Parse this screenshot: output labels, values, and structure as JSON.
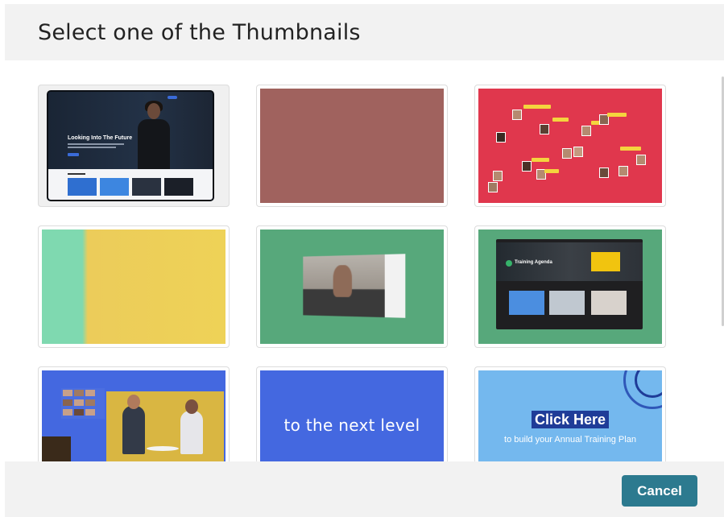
{
  "dialog": {
    "title": "Select one of the Thumbnails",
    "cancel_label": "Cancel"
  },
  "thumbnails": [
    {
      "id": 1,
      "headline": "Looking Into The Future"
    },
    {
      "id": 2
    },
    {
      "id": 3
    },
    {
      "id": 4
    },
    {
      "id": 5
    },
    {
      "id": 6,
      "headline": "Training Agenda"
    },
    {
      "id": 7
    },
    {
      "id": 8,
      "caption": "to the next level"
    },
    {
      "id": 9,
      "caption": "Click Here",
      "subcaption": "to build your Annual Training Plan"
    }
  ],
  "colors": {
    "header_bg": "#f2f2f2",
    "footer_bg": "#f2f2f2",
    "button_bg": "#2c7a8f",
    "button_text": "#ffffff"
  }
}
